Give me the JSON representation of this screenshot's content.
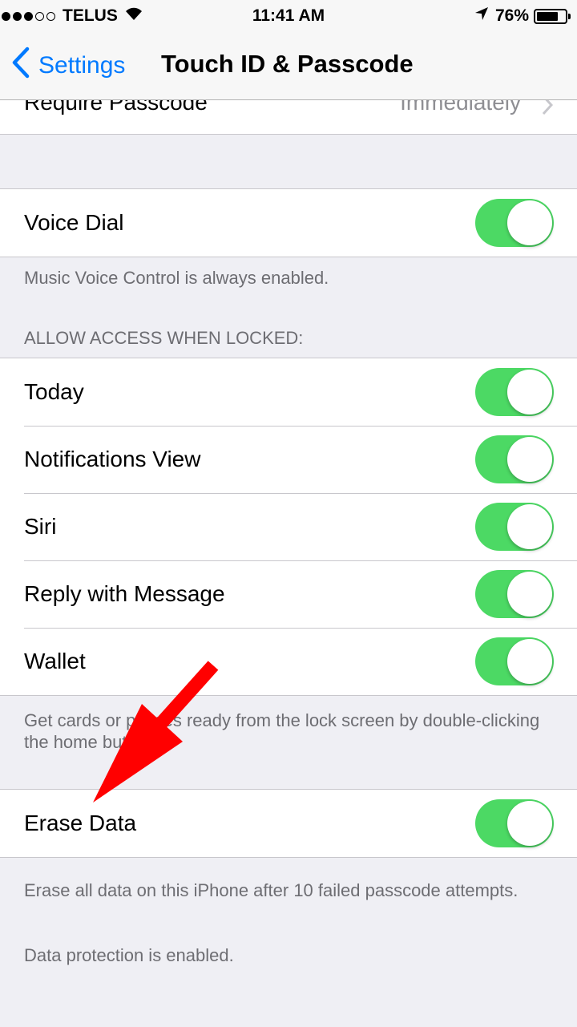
{
  "status_bar": {
    "carrier": "TELUS",
    "time": "11:41 AM",
    "battery": "76%",
    "battery_level": 0.76,
    "signal_bars_filled": 3,
    "signal_bars_total": 5
  },
  "nav": {
    "back_label": "Settings",
    "title": "Touch ID & Passcode"
  },
  "require_passcode": {
    "label": "Require Passcode",
    "value": "Immediately"
  },
  "voice_dial": {
    "label": "Voice Dial",
    "on": true,
    "footer": "Music Voice Control is always enabled."
  },
  "allow_access": {
    "header": "ALLOW ACCESS WHEN LOCKED:",
    "items": [
      {
        "label": "Today",
        "on": true
      },
      {
        "label": "Notifications View",
        "on": true
      },
      {
        "label": "Siri",
        "on": true
      },
      {
        "label": "Reply with Message",
        "on": true
      },
      {
        "label": "Wallet",
        "on": true
      }
    ],
    "footer": "Get cards or passes ready from the lock screen by double-clicking the home button."
  },
  "erase_data": {
    "label": "Erase Data",
    "on": true,
    "footer_1": "Erase all data on this iPhone after 10 failed passcode attempts.",
    "footer_2": "Data protection is enabled."
  },
  "colors": {
    "accent": "#007aff",
    "toggle_on": "#4cd964",
    "annotation_arrow": "#ff0000"
  }
}
